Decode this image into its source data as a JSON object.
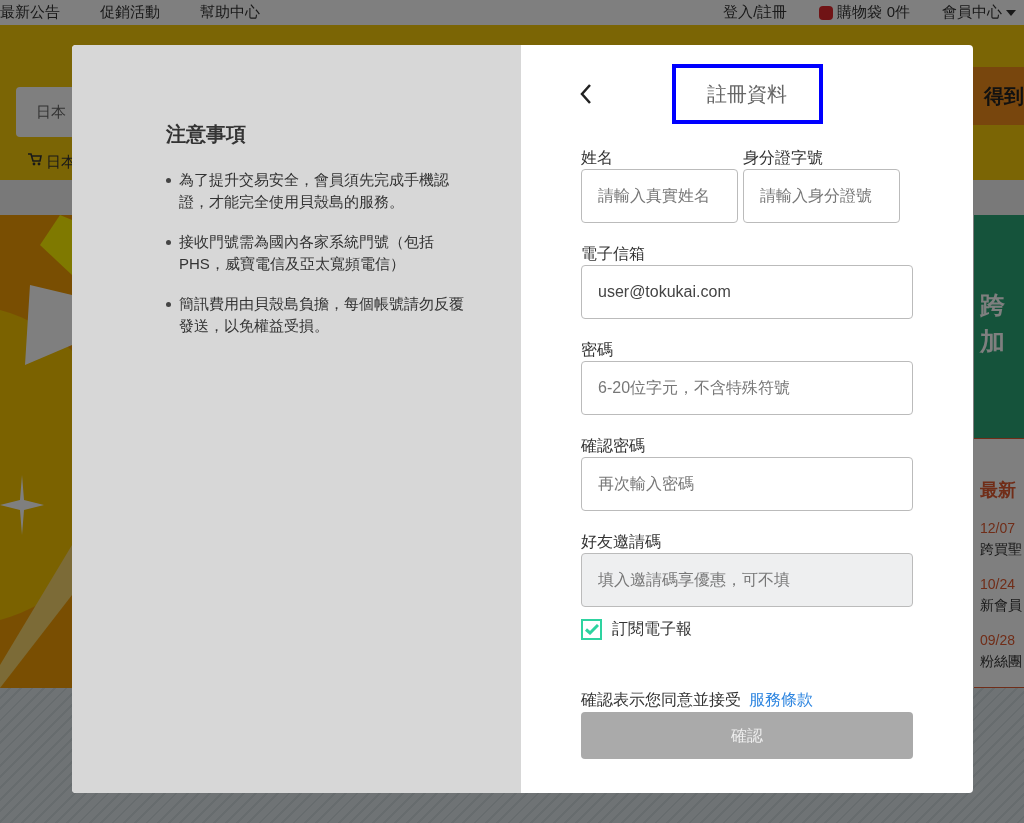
{
  "site_nav": {
    "left_links": [
      "最新公告",
      "促銷活動",
      "幫助中心"
    ],
    "login": "登入/註冊",
    "cart": "購物袋 0件",
    "member": "會員中心"
  },
  "site_header": {
    "search_value": "日本",
    "cart_link": "日本",
    "banner_text": "得到"
  },
  "side_banner": {
    "lines": [
      "跨",
      "加"
    ]
  },
  "news": {
    "title": "最新",
    "items": [
      {
        "date": "12/07",
        "text": "跨買聖"
      },
      {
        "date": "10/24",
        "text": "新會員"
      },
      {
        "date": "09/28",
        "text": "粉絲團"
      }
    ]
  },
  "modal": {
    "notice": {
      "title": "注意事項",
      "items": [
        "為了提升交易安全，會員須先完成手機認證，才能完全使用貝殼島的服務。",
        "接收門號需為國內各家系統門號（包括PHS，威寶電信及亞太寬頻電信）",
        "簡訊費用由貝殼島負擔，每個帳號請勿反覆發送，以免權益受損。"
      ]
    },
    "form": {
      "title": "註冊資料",
      "title_highlighted": true,
      "fields": [
        {
          "label": "姓名",
          "placeholder": "請輸入真實姓名",
          "disabled": false,
          "half": true
        },
        {
          "label": "身分證字號",
          "placeholder": "請輸入身分證號",
          "disabled": false,
          "half": true
        },
        {
          "label": "電子信箱",
          "value": "user@tokukai.com",
          "disabled": false,
          "half": false
        },
        {
          "label": "密碼",
          "placeholder": "6-20位字元，不含特殊符號",
          "disabled": false,
          "half": false
        },
        {
          "label": "確認密碼",
          "placeholder": "再次輸入密碼",
          "disabled": false,
          "half": false
        },
        {
          "label": "好友邀請碼",
          "placeholder": "填入邀請碼享優惠，可不填",
          "disabled": true,
          "half": false
        }
      ],
      "newsletter": {
        "label": "訂閱電子報",
        "checked": true
      },
      "terms": {
        "text": "確認表示您同意並接受",
        "link": "服務條款"
      },
      "submit": {
        "label": "確認",
        "disabled": true
      }
    }
  }
}
